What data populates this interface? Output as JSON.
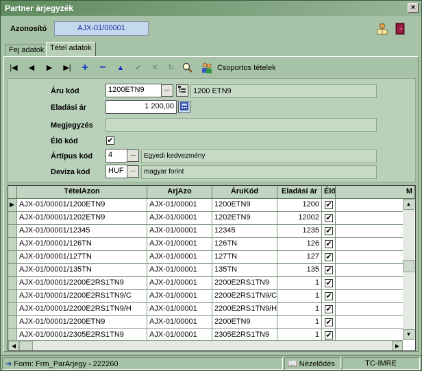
{
  "window": {
    "title": "Partner árjegyzék",
    "close_label": "×"
  },
  "header": {
    "id_label": "Azonosító",
    "id_value": "AJX-01/00001"
  },
  "tabs": [
    {
      "label": "Fej adatok"
    },
    {
      "label": "Tétel adatok"
    }
  ],
  "toolbar": {
    "first": "|◀",
    "prev": "◀",
    "next": "▶",
    "last": "▶|",
    "add": "+",
    "remove": "−",
    "up": "▲",
    "confirm": "✔",
    "cancel": "✕",
    "refresh": "↻",
    "search": "🔍",
    "group_label": "Csoportos tételek"
  },
  "form": {
    "aru_kod_label": "Áru kód",
    "aru_kod_value": "1200ETN9",
    "aru_kod_desc": "1200 ETN9",
    "eladasi_ar_label": "Eladási ár",
    "eladasi_ar_value": "1 200,00",
    "megjegyzes_label": "Megjegyzés",
    "megjegyzes_value": "",
    "elo_kod_label": "Élő kód",
    "elo_kod_checked": true,
    "artipus_label": "Ártípus kód",
    "artipus_value": "4",
    "artipus_desc": "Egyedi kedvezmény",
    "deviza_label": "Deviza kód",
    "deviza_value": "HUF",
    "deviza_desc": "magyar forint",
    "lookup_label": "..."
  },
  "grid": {
    "columns": [
      "TételAzon",
      "ArjAzo",
      "ÁruKód",
      "Eladási ár",
      "Élő",
      "M"
    ],
    "rows": [
      [
        "AJX-01/00001/1200ETN9",
        "AJX-01/00001",
        "1200ETN9",
        "1200",
        true
      ],
      [
        "AJX-01/00001/1202ETN9",
        "AJX-01/00001",
        "1202ETN9",
        "12002",
        true
      ],
      [
        "AJX-01/00001/12345",
        "AJX-01/00001",
        "12345",
        "1235",
        true
      ],
      [
        "AJX-01/00001/126TN",
        "AJX-01/00001",
        "126TN",
        "126",
        true
      ],
      [
        "AJX-01/00001/127TN",
        "AJX-01/00001",
        "127TN",
        "127",
        true
      ],
      [
        "AJX-01/00001/135TN",
        "AJX-01/00001",
        "135TN",
        "135",
        true
      ],
      [
        "AJX-01/00001/2200E2RS1TN9",
        "AJX-01/00001",
        "2200E2RS1TN9",
        "1",
        true
      ],
      [
        "AJX-01/00001/2200E2RS1TN9/C",
        "AJX-01/00001",
        "2200E2RS1TN9/C",
        "1",
        true
      ],
      [
        "AJX-01/00001/2200E2RS1TN9/H",
        "AJX-01/00001",
        "2200E2RS1TN9/H",
        "1",
        true
      ],
      [
        "AJX-01/00001/2200ETN9",
        "AJX-01/00001",
        "2200ETN9",
        "1",
        true
      ],
      [
        "AJX-01/00001/2305E2RS1TN9",
        "AJX-01/00001",
        "2305E2RS1TN9",
        "1",
        true
      ]
    ],
    "current_row": 0
  },
  "status": {
    "form": "Form: Frm_ParArjegy - 222260",
    "mode": "Nézelődés",
    "user": "TC-IMRE"
  },
  "colors": {
    "accent": "#1533c9",
    "background": "#a7c3a7"
  }
}
